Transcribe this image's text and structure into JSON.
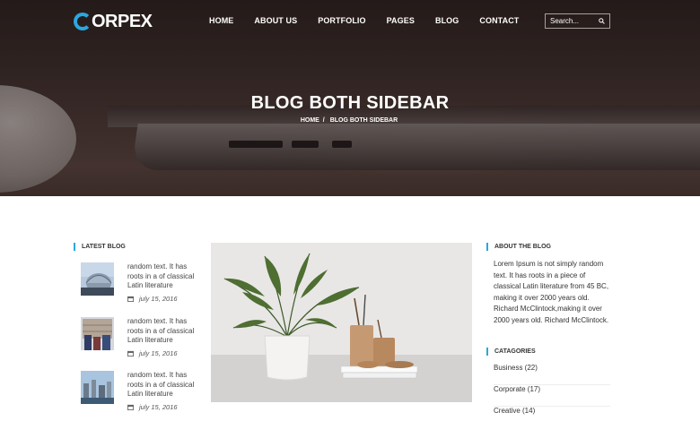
{
  "brand": {
    "logo_text": "ORPEX"
  },
  "nav": {
    "items": [
      "HOME",
      "ABOUT US",
      "PORTFOLIO",
      "PAGES",
      "BLOG",
      "CONTACT"
    ]
  },
  "search": {
    "placeholder": "Search..."
  },
  "hero": {
    "title": "BLOG BOTH SIDEBAR",
    "breadcrumb": {
      "home": "HOME",
      "separator": "/",
      "current": "BLOG BOTH SIDEBAR"
    }
  },
  "latest_blog": {
    "heading": "LATEST BLOG",
    "posts": [
      {
        "text": "random text. It has roots in a of classical Latin literature",
        "date": "july 15, 2016"
      },
      {
        "text": "random text. It has roots in a of classical Latin literature",
        "date": "july 15, 2016"
      },
      {
        "text": "random text. It has roots in a of classical Latin literature",
        "date": "july 15, 2016"
      }
    ]
  },
  "about": {
    "heading": "ABOUT THE BLOG",
    "text": "Lorem Ipsum is not simply random text. It has roots in a piece of classical Latin literature from 45 BC, making it over 2000 years old. Richard McClintock,making it over 2000 years old. Richard McClintock."
  },
  "categories": {
    "heading": "CATAGORIES",
    "items": [
      "Business (22)",
      "Corporate (17)",
      "Creative (14)"
    ]
  },
  "colors": {
    "accent": "#2aa7e0",
    "hero_overlay": "#2b211f"
  },
  "icons": [
    "search-icon",
    "calendar-icon"
  ]
}
